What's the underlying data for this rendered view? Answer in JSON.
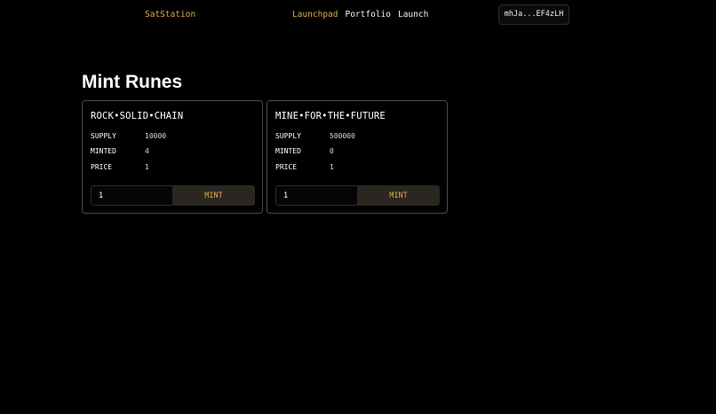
{
  "header": {
    "brand": "SatStation",
    "nav": [
      {
        "label": "Launchpad",
        "active": true
      },
      {
        "label": "Portfolio",
        "active": false
      },
      {
        "label": "Launch",
        "active": false
      }
    ],
    "wallet": "mhJa...EF4zLH"
  },
  "page": {
    "title": "Mint Runes"
  },
  "labels": {
    "supply": "SUPPLY",
    "minted": "MINTED",
    "price": "PRICE",
    "mint_button": "MINT"
  },
  "runes": [
    {
      "name": "ROCK•SOLID•CHAIN",
      "supply": "10000",
      "minted": "4",
      "price": "1",
      "quantity": "1"
    },
    {
      "name": "MINE•FOR•THE•FUTURE",
      "supply": "500000",
      "minted": "0",
      "price": "1",
      "quantity": "1"
    }
  ],
  "colors": {
    "accent": "#e0a94a",
    "background": "#000000",
    "card_border": "#4a4a4a",
    "button_bg": "#2b2620"
  }
}
